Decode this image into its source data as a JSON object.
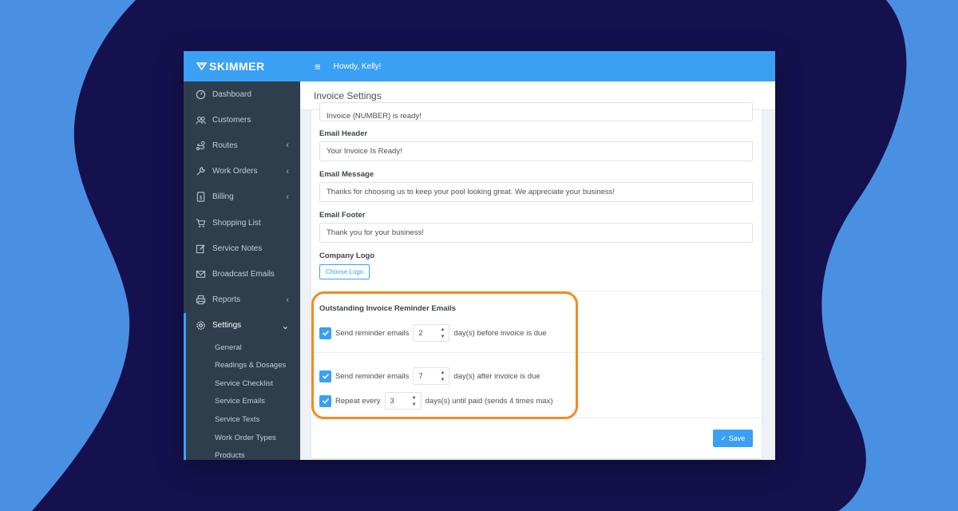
{
  "brand": {
    "name": "SKIMMER"
  },
  "topbar": {
    "menu_icon": "≡",
    "greeting": "Howdy, Kelly!"
  },
  "page": {
    "title": "Invoice Settings"
  },
  "sidebar": {
    "items": [
      {
        "label": "Dashboard",
        "icon": "dashboard-icon",
        "has_chevron": false
      },
      {
        "label": "Customers",
        "icon": "customers-icon",
        "has_chevron": false
      },
      {
        "label": "Routes",
        "icon": "routes-icon",
        "has_chevron": true
      },
      {
        "label": "Work Orders",
        "icon": "wrench-icon",
        "has_chevron": true
      },
      {
        "label": "Billing",
        "icon": "billing-icon",
        "has_chevron": true
      },
      {
        "label": "Shopping List",
        "icon": "cart-icon",
        "has_chevron": false
      },
      {
        "label": "Service Notes",
        "icon": "edit-icon",
        "has_chevron": false
      },
      {
        "label": "Broadcast Emails",
        "icon": "mail-icon",
        "has_chevron": false
      },
      {
        "label": "Reports",
        "icon": "printer-icon",
        "has_chevron": true
      },
      {
        "label": "Settings",
        "icon": "gear-icon",
        "has_chevron": true,
        "active": true
      }
    ],
    "sub_items": [
      "General",
      "Readings & Dosages",
      "Service Checklist",
      "Service Emails",
      "Service Texts",
      "Work Order Types",
      "Products"
    ]
  },
  "form": {
    "subject_value": "Invoice {NUMBER} is ready!",
    "email_header": {
      "label": "Email Header",
      "value": "Your Invoice Is Ready!"
    },
    "email_message": {
      "label": "Email Message",
      "value": "Thanks for choosing us to keep your pool looking great. We appreciate your business!"
    },
    "email_footer": {
      "label": "Email Footer",
      "value": "Thank you for your business!"
    },
    "company_logo": {
      "label": "Company Logo",
      "button": "Choose Logo"
    }
  },
  "reminders": {
    "title": "Outstanding Invoice Reminder Emails",
    "before": {
      "checked": true,
      "prefix": "Send reminder emails",
      "value": "2",
      "suffix": "day(s) before invoice is due"
    },
    "after": {
      "checked": true,
      "prefix": "Send reminder emails",
      "value": "7",
      "suffix": "day(s) after invoice is due"
    },
    "repeat": {
      "checked": true,
      "prefix": "Repeat every",
      "value": "3",
      "suffix": "days(s) until paid (sends 4 times max)"
    }
  },
  "save_button": {
    "label": "Save"
  },
  "colors": {
    "accent": "#3aa0f4",
    "sidebar": "#2f3e4d",
    "highlight": "#f58a1f",
    "background_blue": "#4a90e2",
    "background_navy": "#15114f"
  }
}
